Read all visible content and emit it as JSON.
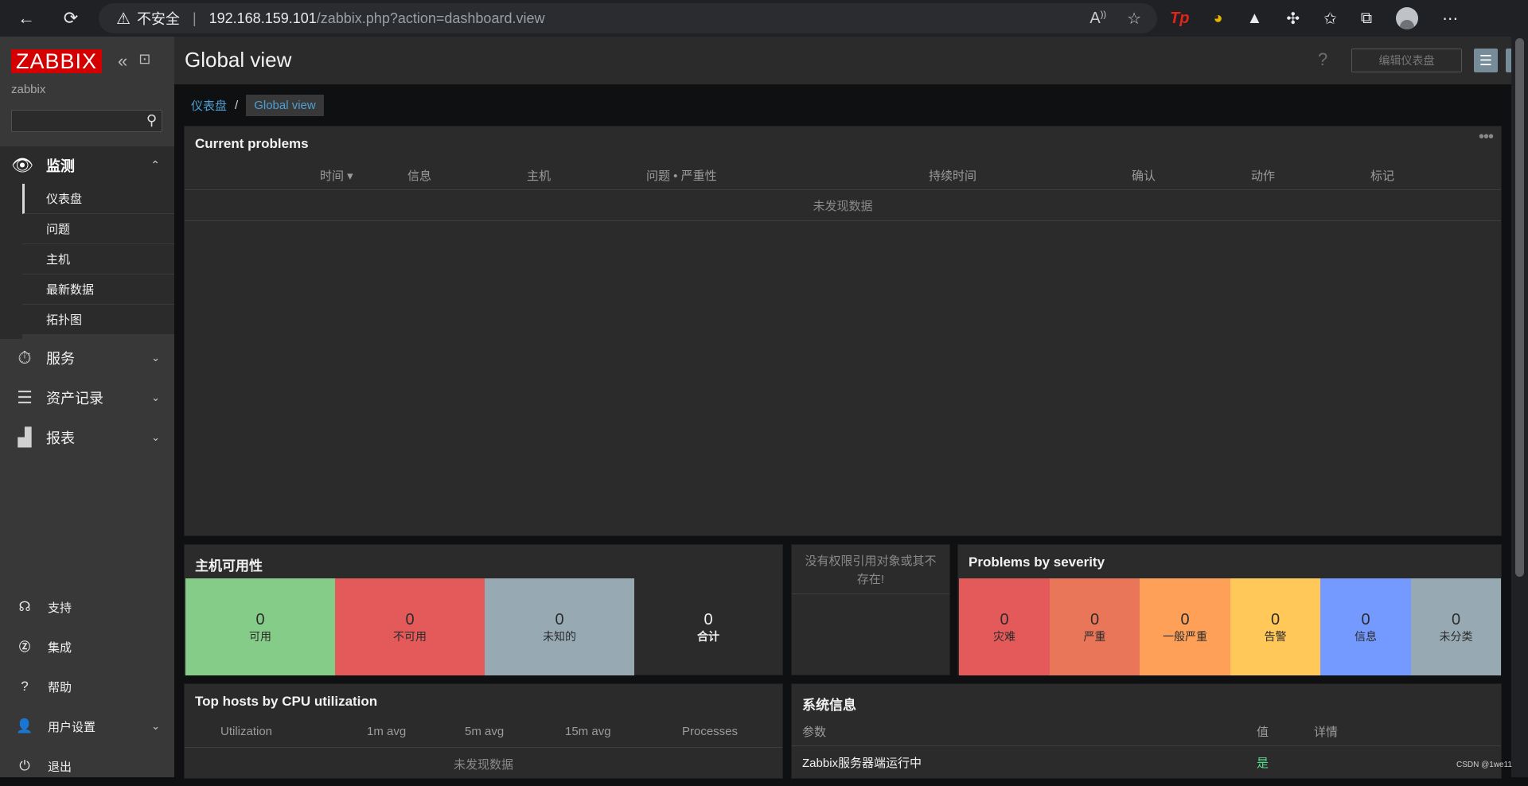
{
  "browser": {
    "warning_text": "不安全",
    "url_host": "192.168.159.101",
    "url_path": "/zabbix.php?action=dashboard.view",
    "ext_tp_label": "Tp"
  },
  "sidebar": {
    "logo": "ZABBIX",
    "server_name": "zabbix",
    "search_value": "",
    "monitoring": {
      "label": "监测",
      "items": [
        "仪表盘",
        "问题",
        "主机",
        "最新数据",
        "拓扑图"
      ],
      "active_index": 0
    },
    "groups": [
      {
        "label": "服务",
        "icon": "stopwatch-icon"
      },
      {
        "label": "资产记录",
        "icon": "list-icon"
      },
      {
        "label": "报表",
        "icon": "bar-chart-icon"
      }
    ],
    "bottom": [
      {
        "label": "支持",
        "icon": "headset-icon",
        "has_chevron": false
      },
      {
        "label": "集成",
        "icon": "z-icon",
        "has_chevron": false
      },
      {
        "label": "帮助",
        "icon": "question-icon",
        "has_chevron": false
      },
      {
        "label": "用户设置",
        "icon": "user-icon",
        "has_chevron": true
      },
      {
        "label": "退出",
        "icon": "power-icon",
        "has_chevron": false
      }
    ]
  },
  "header": {
    "title": "Global view",
    "help": "?",
    "edit_button": "编辑仪表盘"
  },
  "breadcrumb": {
    "root": "仪表盘",
    "separator": "/",
    "current": "Global view"
  },
  "current_problems": {
    "title": "Current problems",
    "columns": [
      "时间 ▾",
      "信息",
      "主机",
      "问题 • 严重性",
      "持续时间",
      "确认",
      "动作",
      "标记"
    ],
    "empty": "未发现数据"
  },
  "host_availability": {
    "title": "主机可用性",
    "cells": [
      {
        "value": "0",
        "label": "可用",
        "color": "#86cc89"
      },
      {
        "value": "0",
        "label": "不可用",
        "color": "#e45959"
      },
      {
        "value": "0",
        "label": "未知的",
        "color": "#97aab3"
      },
      {
        "value": "0",
        "label": "合计",
        "color": "#2b2b2b"
      }
    ]
  },
  "no_permission": {
    "text": "没有权限引用对象或其不存在!"
  },
  "problems_by_severity": {
    "title": "Problems by severity",
    "cells": [
      {
        "value": "0",
        "label": "灾难",
        "color": "#e45959"
      },
      {
        "value": "0",
        "label": "严重",
        "color": "#e97659"
      },
      {
        "value": "0",
        "label": "一般严重",
        "color": "#ffa059"
      },
      {
        "value": "0",
        "label": "告警",
        "color": "#ffc859"
      },
      {
        "value": "0",
        "label": "信息",
        "color": "#7499ff"
      },
      {
        "value": "0",
        "label": "未分类",
        "color": "#97aab3"
      }
    ]
  },
  "top_hosts": {
    "title": "Top hosts by CPU utilization",
    "columns": [
      "Utilization",
      "1m avg",
      "5m avg",
      "15m avg",
      "Processes"
    ],
    "empty": "未发现数据"
  },
  "system_info": {
    "title": "系统信息",
    "columns": [
      "参数",
      "值",
      "详情"
    ],
    "rows": [
      {
        "param": "Zabbix服务器端运行中",
        "value": "是",
        "details": ""
      }
    ]
  },
  "watermark": "CSDN @1we11"
}
